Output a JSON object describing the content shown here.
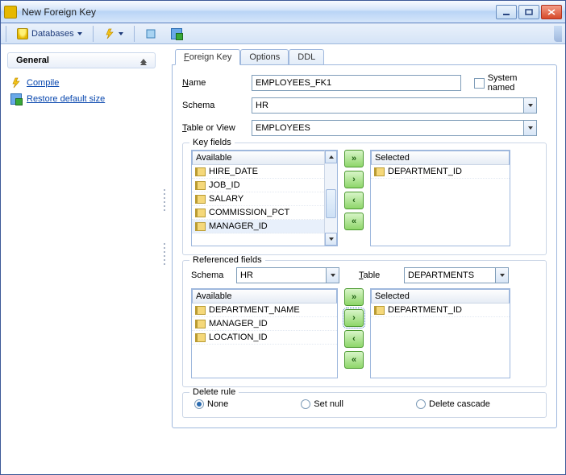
{
  "window": {
    "title": "New Foreign Key"
  },
  "toolbar": {
    "databases_label": "Databases"
  },
  "sidenav": {
    "header": "General",
    "links": [
      {
        "label": "Compile"
      },
      {
        "label": "Restore default size"
      }
    ]
  },
  "tabs": [
    {
      "label": "Foreign Key",
      "active": true
    },
    {
      "label": "Options",
      "active": false
    },
    {
      "label": "DDL",
      "active": false
    }
  ],
  "form": {
    "name_label": "Name",
    "name_value": "EMPLOYEES_FK1",
    "system_named_label": "System named",
    "system_named_checked": false,
    "schema_label": "Schema",
    "schema_value": "HR",
    "table_label": "Table or View",
    "table_value": "EMPLOYEES"
  },
  "key_fields": {
    "legend": "Key fields",
    "available_label": "Available",
    "selected_label": "Selected",
    "available": [
      "HIRE_DATE",
      "JOB_ID",
      "SALARY",
      "COMMISSION_PCT",
      "MANAGER_ID"
    ],
    "selected": [
      "DEPARTMENT_ID"
    ]
  },
  "ref_fields": {
    "legend": "Referenced fields",
    "schema_label": "Schema",
    "schema_value": "HR",
    "table_label": "Table",
    "table_value": "DEPARTMENTS",
    "available_label": "Available",
    "selected_label": "Selected",
    "available": [
      "DEPARTMENT_NAME",
      "MANAGER_ID",
      "LOCATION_ID"
    ],
    "selected": [
      "DEPARTMENT_ID"
    ]
  },
  "delete_rule": {
    "legend": "Delete rule",
    "options": [
      {
        "label": "None",
        "checked": true
      },
      {
        "label": "Set null",
        "checked": false
      },
      {
        "label": "Delete cascade",
        "checked": false
      }
    ]
  }
}
